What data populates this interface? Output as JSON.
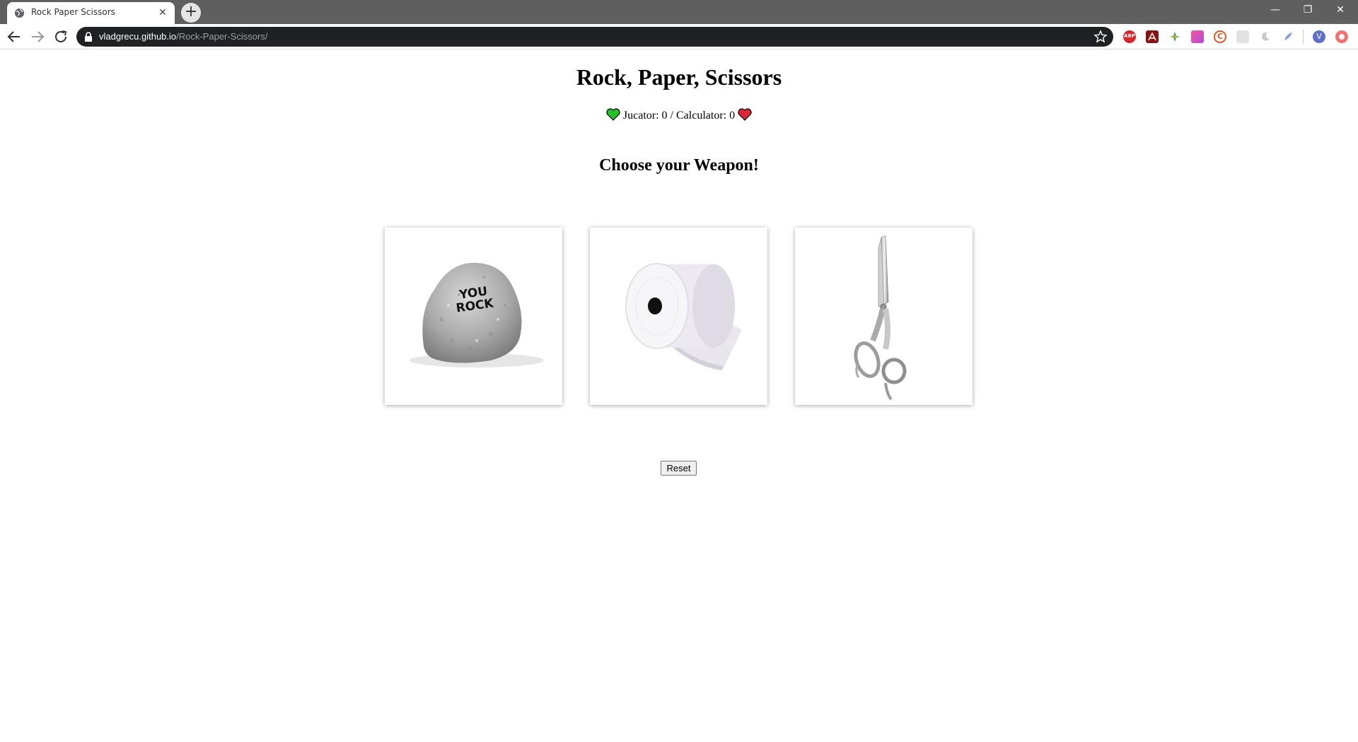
{
  "browser": {
    "tab_title": "Rock Paper Scissors",
    "url_host": "vladgrecu.github.io",
    "url_path": "/Rock-Paper-Scissors/",
    "profile_initial": "V",
    "extensions": [
      "adblock-icon",
      "acrobat-icon",
      "extension-icon",
      "gradient-extension-icon",
      "c-extension-icon",
      "puzzle-extension-icon",
      "moon-extension-icon",
      "feather-extension-icon"
    ]
  },
  "game": {
    "title": "Rock, Paper, Scissors",
    "player_label": "Jucator: ",
    "player_score": "0",
    "separator": " / ",
    "computer_label": "Calculator: ",
    "computer_score": "0",
    "prompt": "Choose your Weapon!",
    "rock_text_line1": "YOU",
    "rock_text_line2": "ROCK",
    "choices": [
      "rock",
      "paper",
      "scissors"
    ],
    "reset_label": "Reset"
  },
  "colors": {
    "player_heart": "#22c022",
    "computer_heart": "#e0243a",
    "tabbar": "#5f5f5f",
    "omnibox": "#202124"
  }
}
